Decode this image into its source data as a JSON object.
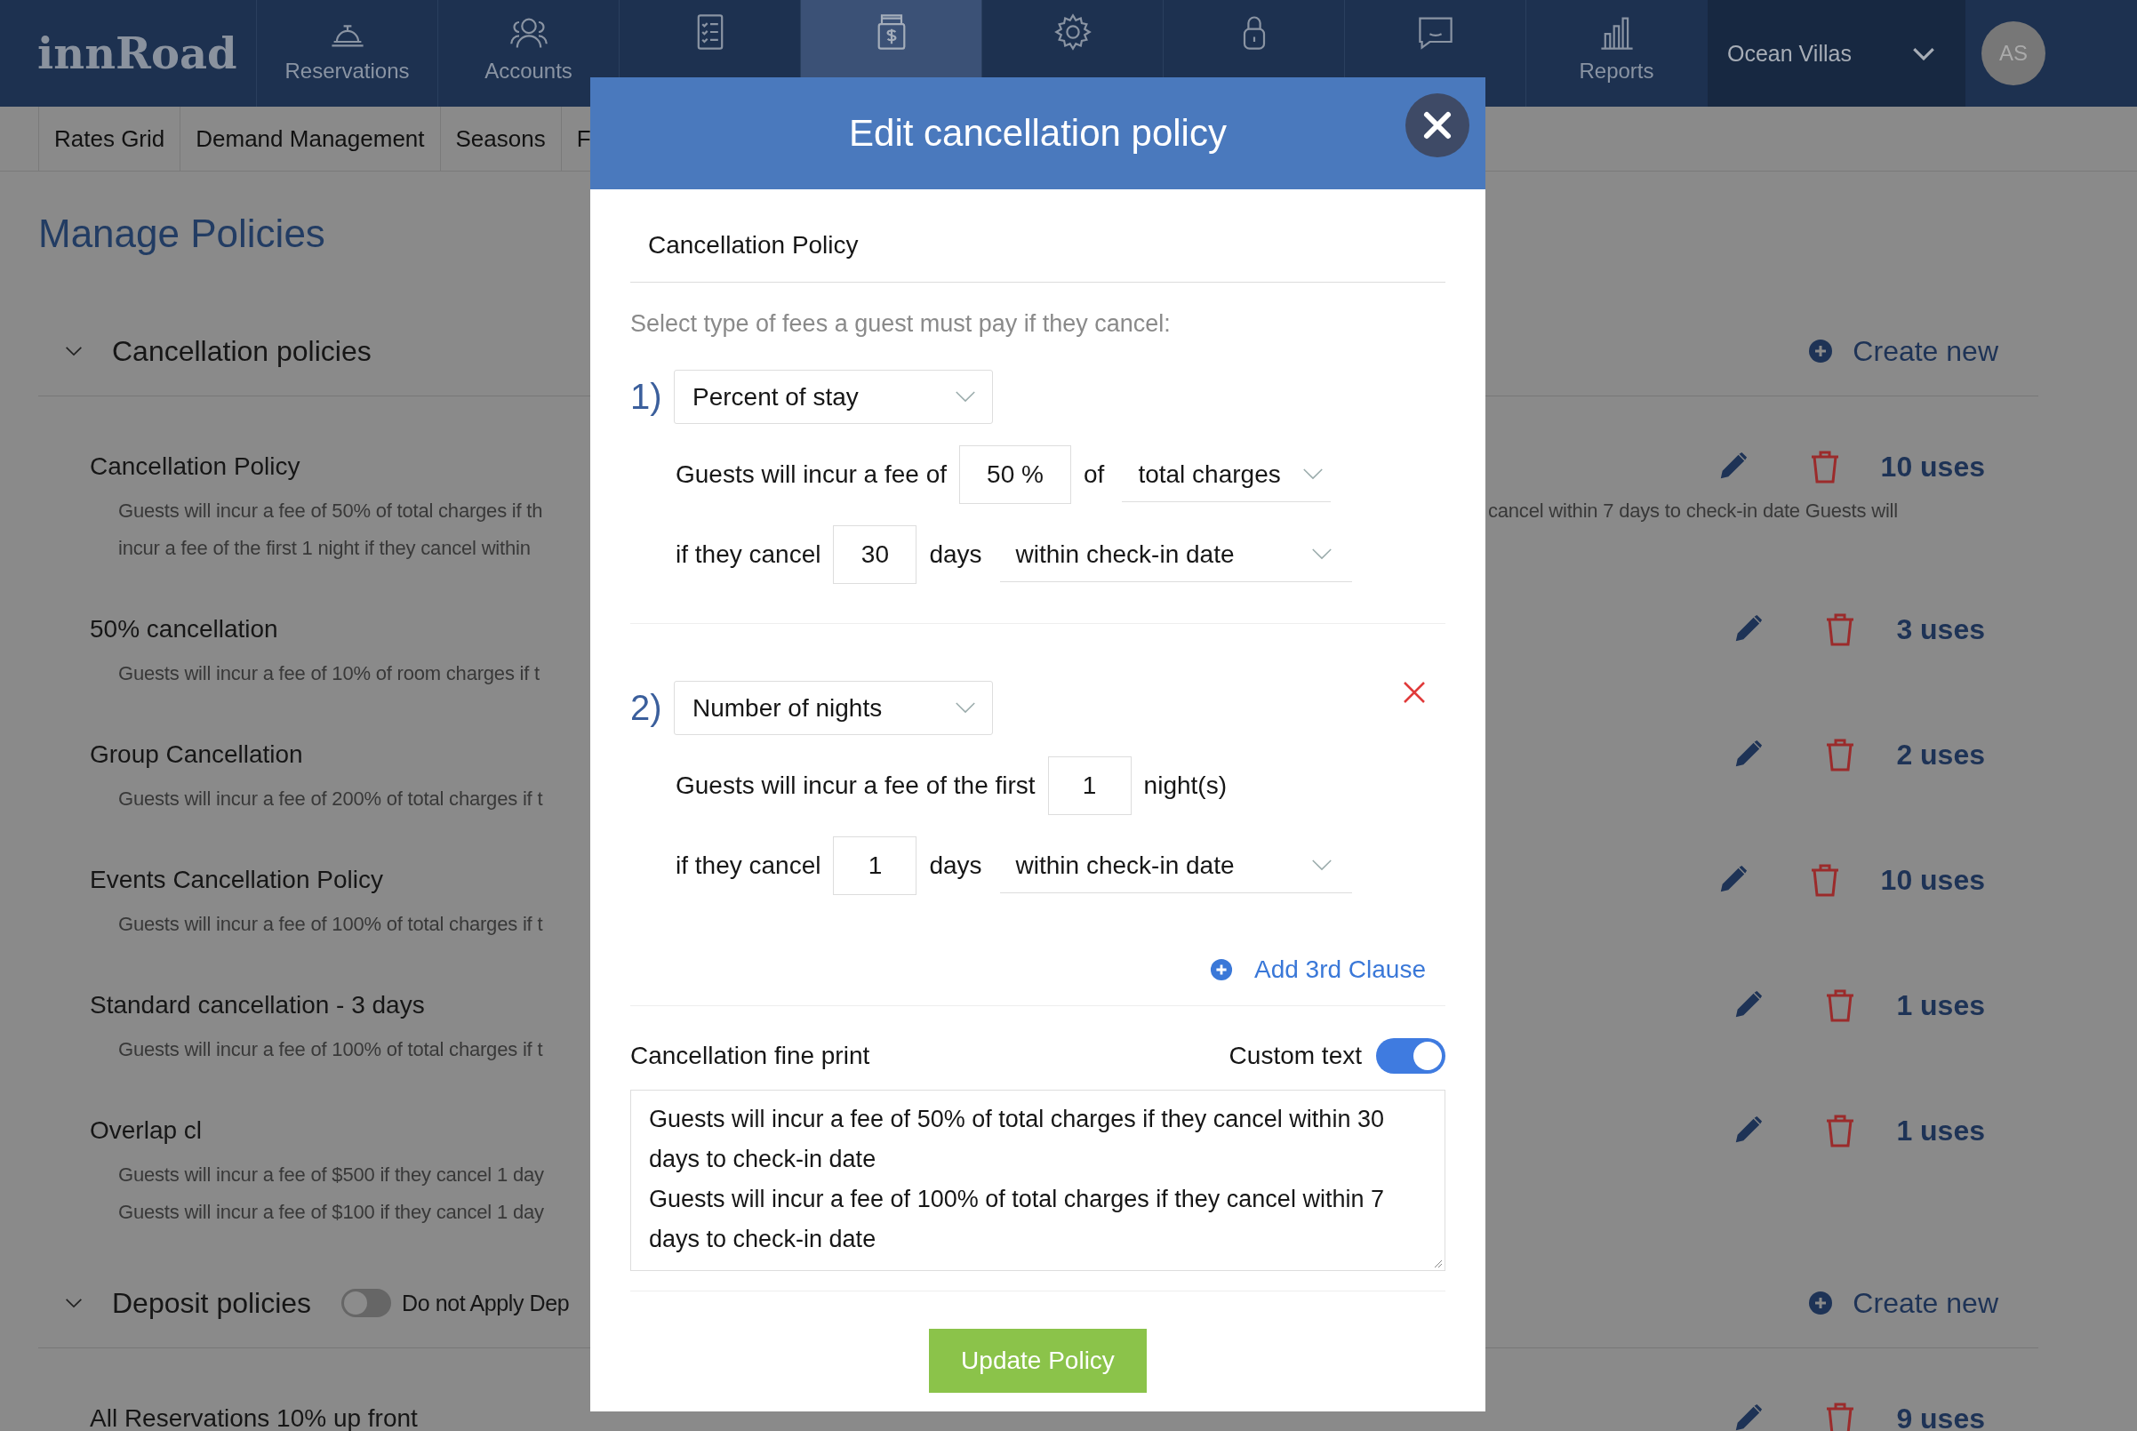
{
  "app": {
    "logo": "innRoad"
  },
  "nav": [
    {
      "label": "Reservations",
      "selected": false
    },
    {
      "label": "Accounts",
      "selected": false
    },
    {
      "selected": false
    },
    {
      "selected": true
    },
    {
      "selected": false
    },
    {
      "selected": false
    },
    {
      "selected": false
    },
    {
      "label": "Reports",
      "selected": false
    }
  ],
  "property": {
    "name": "Ocean Villas"
  },
  "user": {
    "initials": "AS"
  },
  "subnav": [
    {
      "label": "Rates Grid"
    },
    {
      "label": "Demand Management"
    },
    {
      "label": "Seasons"
    },
    {
      "label": "F"
    }
  ],
  "page_title": "Manage Policies",
  "sections": [
    {
      "title": "Cancellation policies",
      "expanded": true,
      "create_label": "Create new",
      "policies": [
        {
          "name": "Cancellation Policy",
          "uses": "10 uses",
          "description_lines": [
            {
              "text": "Guests will incur a fee of 50% of total charges if th",
              "after_dialog": "cancel within 7 days to check-in date Guests will"
            },
            {
              "text": "incur a fee of the first 1 night if they cancel within"
            }
          ]
        },
        {
          "name": "50% cancellation",
          "uses": "3 uses",
          "description_lines": [
            {
              "text": "Guests will incur a fee of 10% of room charges if t"
            }
          ]
        },
        {
          "name": "Group Cancellation",
          "uses": "2 uses",
          "description_lines": [
            {
              "text": "Guests will incur a fee of 200% of total charges if t"
            }
          ]
        },
        {
          "name": "Events Cancellation Policy",
          "uses": "10 uses",
          "description_lines": [
            {
              "text": "Guests will incur a fee of 100% of total charges if t"
            }
          ]
        },
        {
          "name": "Standard cancellation - 3 days",
          "uses": "1 uses",
          "description_lines": [
            {
              "text": "Guests will incur a fee of 100% of total charges if t"
            }
          ]
        },
        {
          "name": "Overlap cl",
          "uses": "1 uses",
          "description_lines": [
            {
              "text": "Guests will incur a fee of $500 if they cancel 1 day"
            },
            {
              "text": "Guests will incur a fee of $100 if they cancel 1 day"
            }
          ]
        }
      ]
    },
    {
      "title": "Deposit policies",
      "expanded": true,
      "toggle": {
        "label": "Do not Apply Dep",
        "on": false
      },
      "create_label": "Create new",
      "policies": [
        {
          "name": "All Reservations 10% up front",
          "uses": "9 uses"
        }
      ]
    }
  ],
  "dialog": {
    "title": "Edit cancellation policy",
    "name_value": "Cancellation Policy",
    "hint": "Select type of fees a guest must pay if they cancel:",
    "clauses": [
      {
        "number": "1)",
        "kind": "percent",
        "type": "Percent of stay",
        "fee_label": "Guests will incur a fee of",
        "fee_value": "50 %",
        "fee_joiner": "of",
        "fee_basis": "total charges",
        "cancel_label": "if they cancel",
        "days_value": "30",
        "days_label": "days",
        "window": "within check-in date",
        "removable": false
      },
      {
        "number": "2)",
        "kind": "nights",
        "type": "Number of nights",
        "fee_label": "Guests will incur a fee of the first",
        "fee_value": "1",
        "fee_unit": "night(s)",
        "cancel_label": "if they cancel",
        "days_value": "1",
        "days_label": "days",
        "window": "within check-in date",
        "removable": true
      }
    ],
    "add_clause": "Add 3rd Clause",
    "fine_print_label": "Cancellation fine print",
    "custom_text": {
      "label": "Custom text",
      "on": true
    },
    "fine_print": [
      "Guests will incur a fee of 50% of total charges if they cancel within 30 days to check-in date",
      "Guests will incur a fee of 100% of total charges if they cancel within 7 days to check-in date"
    ],
    "submit": "Update Policy"
  }
}
